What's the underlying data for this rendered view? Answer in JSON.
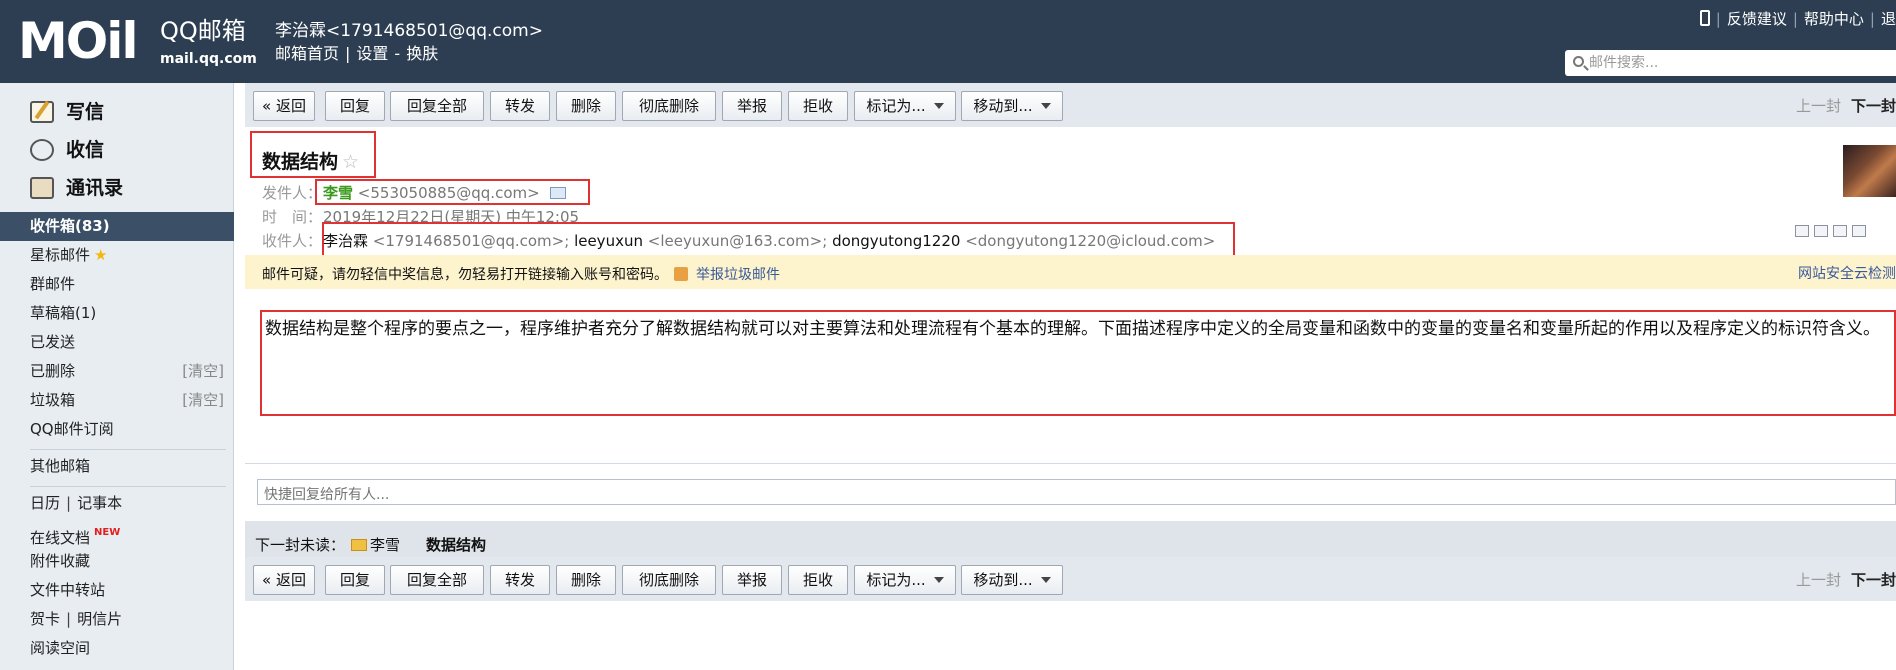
{
  "header": {
    "logo_text": "MOil",
    "logo_cn": "QQ邮箱",
    "logo_url": "mail.qq.com",
    "user_display": "李治霖<1791468501@qq.com>",
    "links": [
      "邮箱首页",
      "设置",
      "换肤"
    ],
    "top_links": [
      "反馈建议",
      "帮助中心",
      "退"
    ],
    "search_placeholder": "邮件搜索..."
  },
  "sidebar": {
    "main_items": [
      {
        "label": "写信",
        "icon": "write-icon"
      },
      {
        "label": "收信",
        "icon": "inbox-icon"
      },
      {
        "label": "通讯录",
        "icon": "contacts-icon"
      }
    ],
    "folders": {
      "inbox": "收件箱(83)",
      "starred": "星标邮件",
      "groups": "群邮件",
      "drafts": "草稿箱(1)",
      "sent": "已发送",
      "deleted": "已删除",
      "spam": "垃圾箱",
      "clear": "[清空]",
      "subscription": "QQ邮件订阅",
      "other": "其他邮箱",
      "calendar": "日历",
      "notes": "记事本",
      "docs": "在线文档",
      "new_badge": "NEW",
      "attachments": "附件收藏",
      "transfer": "文件中转站",
      "card": "贺卡",
      "postcard": "明信片",
      "reading": "阅读空间"
    }
  },
  "toolbar": {
    "back": "« 返回",
    "reply": "回复",
    "reply_all": "回复全部",
    "forward": "转发",
    "delete": "删除",
    "delete_forever": "彻底删除",
    "report": "举报",
    "reject": "拒收",
    "mark_as": "标记为...",
    "move_to": "移动到...",
    "prev": "上一封",
    "next": "下一封"
  },
  "email": {
    "subject": "数据结构",
    "from_label": "发件人：",
    "from_name": "李雪",
    "from_addr": "<553050885@qq.com>",
    "time_label": "时　间：",
    "time_value": "2019年12月22日(星期天) 中午12:05",
    "to_label": "收件人：",
    "to": [
      {
        "name": "李治霖",
        "addr": "<1791468501@qq.com>;"
      },
      {
        "name": "leeyuxun",
        "addr": "<leeyuxun@163.com>;"
      },
      {
        "name": "dongyutong1220",
        "addr": "<dongyutong1220@icloud.com>"
      }
    ],
    "warning": "邮件可疑，请勿轻信中奖信息，勿轻易打开链接输入账号和密码。",
    "report_spam": "举报垃圾邮件",
    "safety_check": "网站安全云检测",
    "body": "数据结构是整个程序的要点之一，程序维护者充分了解数据结构就可以对主要算法和处理流程有个基本的理解。下面描述程序中定义的全局变量和函数中的变量的变量名和变量所起的作用以及程序定义的标识符含义。"
  },
  "reply_placeholder": "快捷回复给所有人...",
  "next_unread": {
    "label": "下一封未读：",
    "sender": "李雪",
    "subject": "数据结构"
  }
}
